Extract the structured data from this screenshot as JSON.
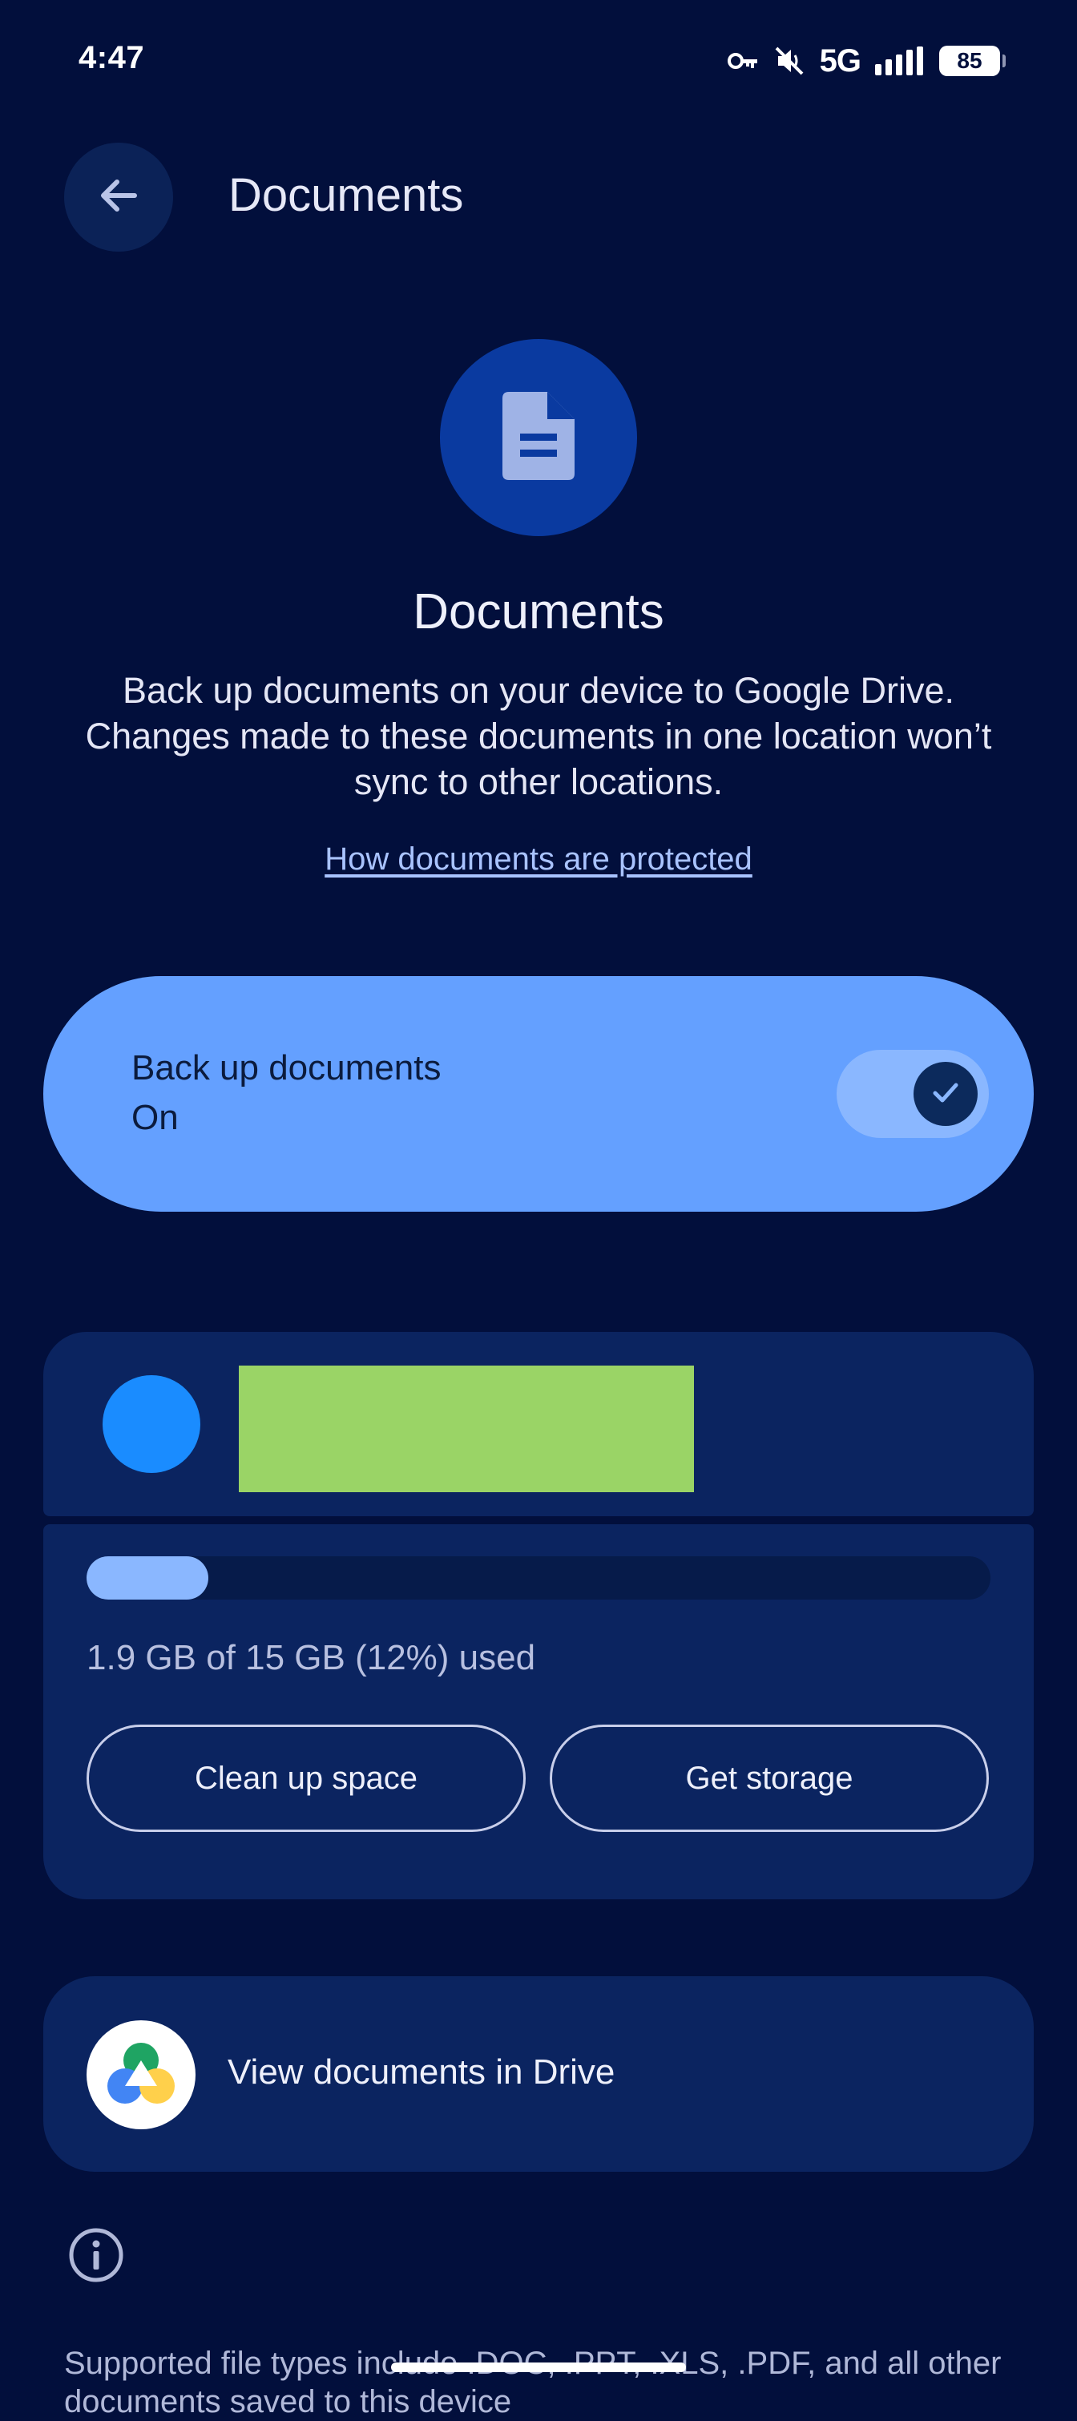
{
  "status_bar": {
    "time": "4:47",
    "network": "5G",
    "battery": "85",
    "icons": [
      "vpn-key-icon",
      "mute-icon",
      "signal-icon",
      "battery-icon"
    ]
  },
  "header": {
    "title": "Documents",
    "back_icon": "arrow-back-icon"
  },
  "hero": {
    "icon": "document-icon",
    "title": "Documents",
    "description": "Back up documents on your device to Google Drive. Changes made to these documents in one location won’t sync to other locations.",
    "link": "How documents are protected"
  },
  "backup": {
    "title": "Back up documents",
    "state": "On",
    "enabled": true
  },
  "storage": {
    "used_fraction": 0.12,
    "usage_text": "1.9 GB of 15 GB (12%) used",
    "cleanup_label": "Clean up space",
    "get_storage_label": "Get storage"
  },
  "drive": {
    "label": "View documents in Drive"
  },
  "footer": {
    "info_icon": "info-icon",
    "note": "Supported file types include .DOC, .PPT, .XLS, .PDF, and all other documents saved to this device"
  },
  "colors": {
    "background": "#020f3c",
    "card": "#0b2460",
    "accent": "#64a0ff",
    "link": "#a9c3ff",
    "avatar": "#1a8cff"
  }
}
